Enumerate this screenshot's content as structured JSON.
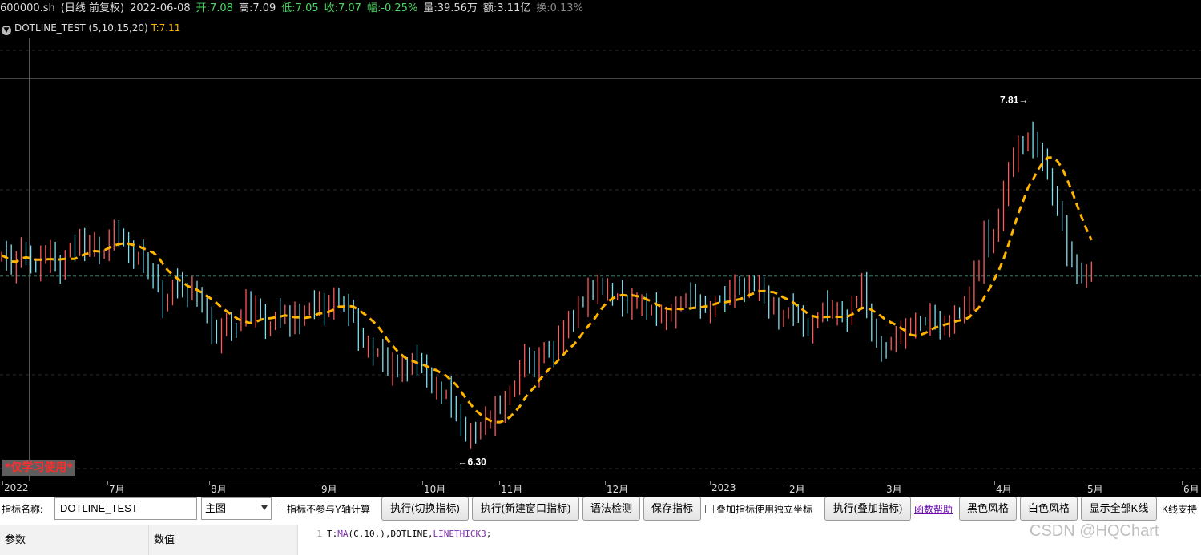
{
  "header": {
    "symbol": "600000.sh",
    "period_adj": "(日线 前复权)",
    "date": "2022-06-08",
    "open": "开:7.08",
    "high": "高:7.09",
    "low": "低:7.05",
    "close": "收:7.07",
    "change": "幅:-0.25%",
    "volume": "量:39.56万",
    "amount": "额:3.11亿",
    "turnover": "换:0.13%"
  },
  "indicator": {
    "name_params": "DOTLINE_TEST (5,10,15,20)",
    "value": "T:7.11",
    "line_color": "#ffb400"
  },
  "chart_data": {
    "type": "candlestick",
    "symbol": "600000.sh",
    "period": "日线",
    "x_labels": [
      "2022",
      "7月",
      "8月",
      "9月",
      "10月",
      "11月",
      "12月",
      "2023",
      "2月",
      "3月",
      "4月",
      "5月",
      "6月"
    ],
    "price_ylim": [
      6.18,
      7.93
    ],
    "current_price": 7.07,
    "max_annotation": {
      "value": 7.81,
      "text": "7.81→",
      "month": "5月"
    },
    "min_annotation": {
      "value": 6.3,
      "text": "←6.30",
      "month": "11月"
    },
    "closes": [
      7.16,
      7.14,
      7.1,
      7.13,
      7.2,
      7.18,
      7.12,
      7.1,
      7.14,
      7.15,
      7.18,
      7.12,
      7.1,
      7.16,
      7.2,
      7.18,
      7.22,
      7.19,
      7.21,
      7.23,
      7.16,
      7.17,
      7.21,
      7.26,
      7.25,
      7.23,
      7.19,
      7.14,
      7.16,
      7.13,
      7.08,
      7.07,
      7.03,
      6.95,
      6.97,
      7.04,
      7.02,
      7.0,
      6.99,
      7.03,
      7.0,
      6.95,
      6.88,
      6.82,
      6.8,
      6.84,
      6.87,
      6.85,
      6.84,
      6.91,
      6.95,
      6.89,
      6.94,
      6.91,
      6.86,
      6.85,
      6.9,
      6.89,
      6.89,
      6.86,
      6.92,
      6.88,
      6.92,
      6.94,
      6.93,
      6.95,
      6.91,
      6.95,
      6.99,
      6.98,
      6.93,
      6.9,
      6.89,
      6.8,
      6.79,
      6.78,
      6.72,
      6.74,
      6.7,
      6.66,
      6.69,
      6.66,
      6.7,
      6.65,
      6.72,
      6.68,
      6.67,
      6.64,
      6.59,
      6.6,
      6.55,
      6.56,
      6.5,
      6.46,
      6.43,
      6.38,
      6.4,
      6.38,
      6.42,
      6.44,
      6.43,
      6.5,
      6.5,
      6.54,
      6.57,
      6.6,
      6.64,
      6.72,
      6.7,
      6.66,
      6.73,
      6.76,
      6.73,
      6.72,
      6.8,
      6.83,
      6.88,
      6.89,
      6.96,
      6.95,
      7.0,
      6.99,
      7.03,
      7.02,
      7.03,
      6.98,
      6.98,
      6.94,
      6.93,
      6.97,
      6.96,
      6.96,
      6.92,
      6.93,
      6.9,
      6.89,
      6.89,
      6.91,
      6.95,
      6.96,
      6.98,
      6.97,
      6.95,
      6.94,
      6.94,
      6.93,
      6.96,
      6.97,
      6.96,
      7.0,
      7.03,
      7.02,
      7.02,
      7.05,
      7.02,
      7.01,
      6.97,
      6.94,
      6.94,
      6.9,
      6.9,
      6.92,
      6.9,
      6.89,
      6.86,
      6.84,
      6.87,
      6.89,
      6.94,
      6.92,
      6.91,
      6.91,
      6.9,
      6.89,
      6.96,
      6.97,
      7.02,
      6.91,
      6.84,
      6.79,
      6.76,
      6.75,
      6.79,
      6.79,
      6.82,
      6.84,
      6.85,
      6.88,
      6.87,
      6.87,
      6.89,
      6.86,
      6.85,
      6.86,
      6.87,
      6.92,
      6.9,
      6.92,
      6.97,
      7.09,
      7.1,
      7.28,
      7.19,
      7.26,
      7.3,
      7.43,
      7.52,
      7.59,
      7.65,
      7.64,
      7.68,
      7.63,
      7.61,
      7.58,
      7.52,
      7.44,
      7.37,
      7.28,
      7.16,
      7.13,
      7.09,
      7.07,
      7.09,
      7.11
    ]
  },
  "badges": {
    "study_only": "*仅学习使用*"
  },
  "toolbar": {
    "name_label": "指标名称:",
    "name_value": "DOTLINE_TEST",
    "main_select": "主图",
    "no_y_label": "指标不参与Y轴计算",
    "exec_switch": "执行(切换指标)",
    "exec_new": "执行(新建窗口指标)",
    "syntax_check": "语法检测",
    "save": "保存指标",
    "overlay_label": "叠加指标使用独立坐标",
    "exec_overlay": "执行(叠加指标)",
    "func_help": "函数帮助",
    "black_style": "黑色风格",
    "white_style": "白色风格",
    "show_all": "显示全部K线",
    "kline_support": "K线支持"
  },
  "params_table": {
    "col_param": "参数",
    "col_value": "数值"
  },
  "editor": {
    "line_no": "1",
    "code_prefix": "T:",
    "code_fn": "MA",
    "code_args": "(C,10,),",
    "code_kw1": "DOTLINE",
    "code_sep": ",",
    "code_kw2": "LINETHICK3",
    "code_end": ";"
  },
  "watermark": "CSDN @HQChart",
  "colors": {
    "up": "#ff5a5a",
    "down": "#7fe0f0",
    "ma": "#ffb400",
    "bg": "#000000"
  }
}
